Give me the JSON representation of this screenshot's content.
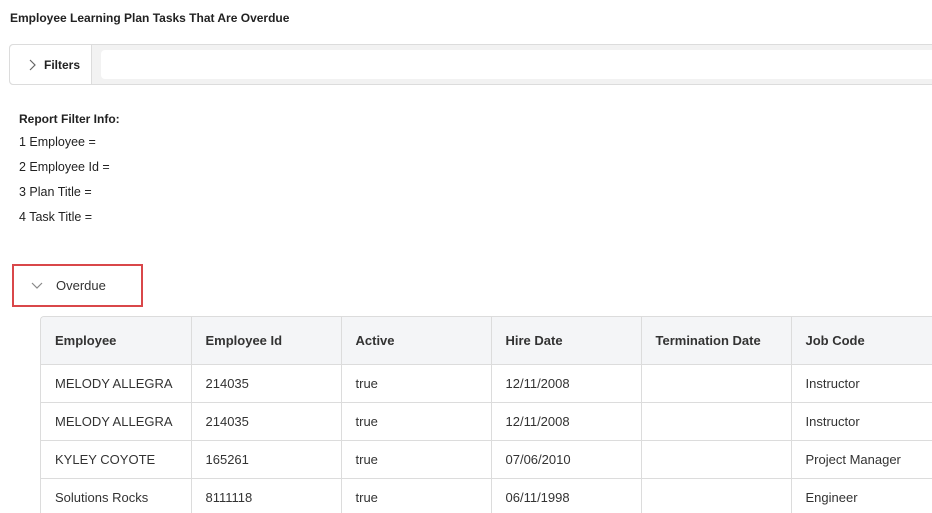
{
  "page": {
    "title": "Employee Learning Plan Tasks That Are Overdue"
  },
  "filters": {
    "label": "Filters",
    "icon": "chevron-right-icon",
    "input_value": ""
  },
  "report_filter_info": {
    "heading": "Report Filter Info:",
    "lines": [
      "1 Employee =",
      "2 Employee Id =",
      "3 Plan Title =",
      "4 Task Title ="
    ]
  },
  "group": {
    "label": "Overdue",
    "icon": "chevron-down-icon",
    "highlight_color": "#d9474a"
  },
  "table": {
    "columns": [
      "Employee",
      "Employee Id",
      "Active",
      "Hire Date",
      "Termination Date",
      "Job Code"
    ],
    "rows": [
      [
        "MELODY ALLEGRA",
        "214035",
        "true",
        "12/11/2008",
        "",
        "Instructor"
      ],
      [
        "MELODY ALLEGRA",
        "214035",
        "true",
        "12/11/2008",
        "",
        "Instructor"
      ],
      [
        "KYLEY COYOTE",
        "165261",
        "true",
        "07/06/2010",
        "",
        "Project Manager"
      ],
      [
        "Solutions Rocks",
        "8111118",
        "true",
        "06/11/1998",
        "",
        "Engineer"
      ]
    ]
  }
}
